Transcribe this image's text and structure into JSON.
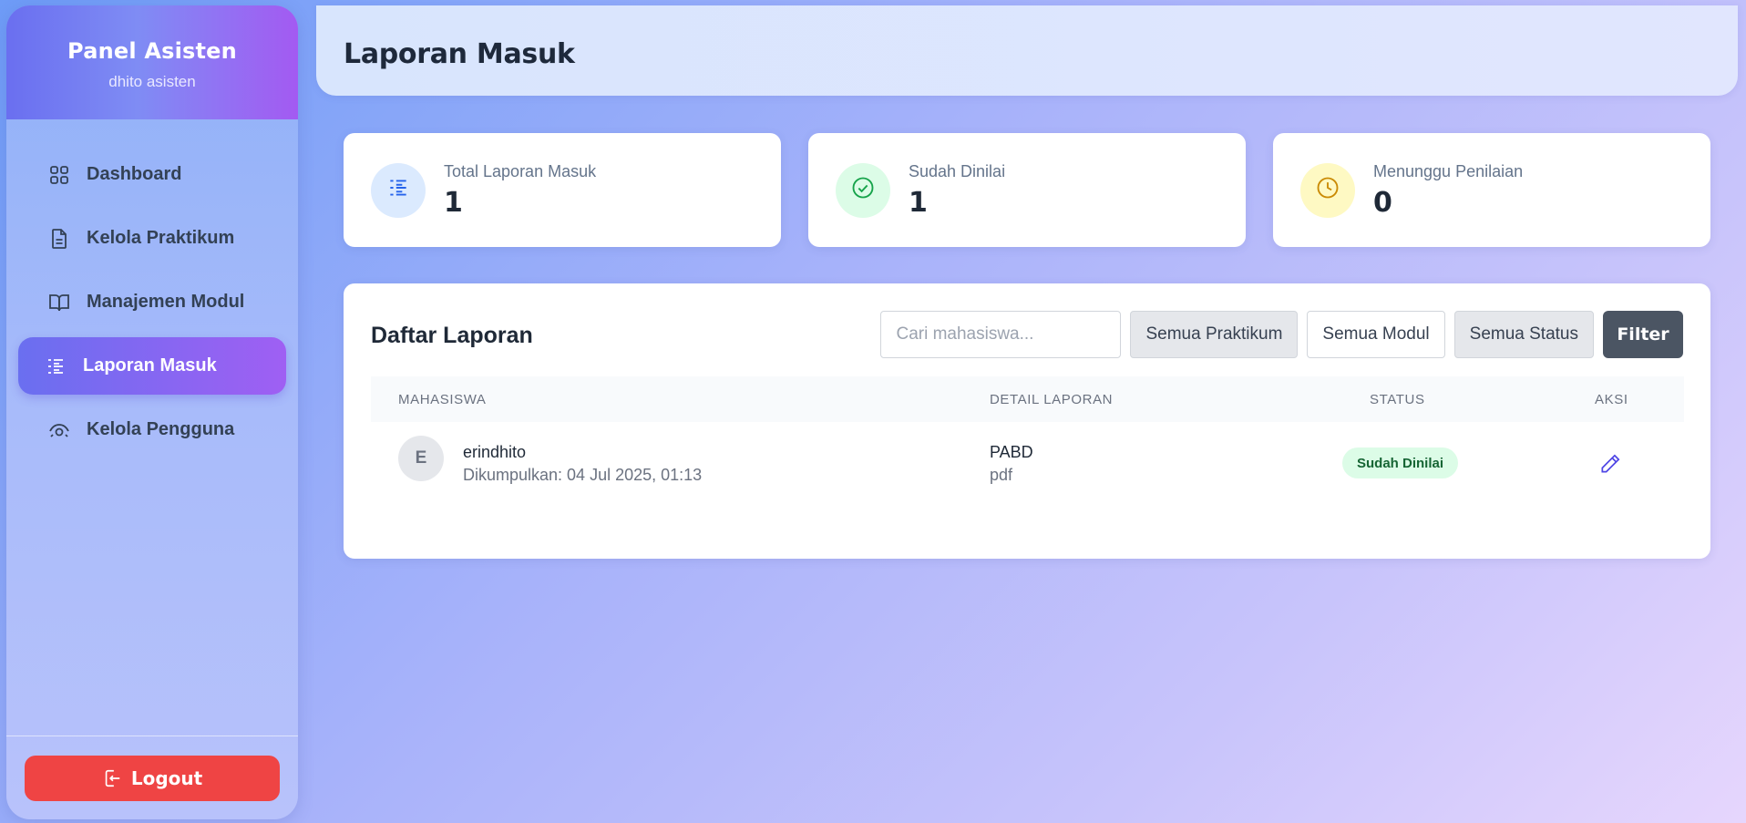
{
  "sidebar": {
    "title": "Panel Asisten",
    "subtitle": "dhito asisten",
    "items": [
      {
        "label": "Dashboard",
        "icon": "grid-icon"
      },
      {
        "label": "Kelola Praktikum",
        "icon": "document-icon"
      },
      {
        "label": "Manajemen Modul",
        "icon": "book-icon"
      },
      {
        "label": "Laporan Masuk",
        "icon": "list-icon",
        "active": true
      },
      {
        "label": "Kelola Pengguna",
        "icon": "eye-icon"
      }
    ],
    "logout_label": "Logout"
  },
  "header": {
    "title": "Laporan Masuk"
  },
  "stats": [
    {
      "label": "Total Laporan Masuk",
      "value": "1",
      "color": "#2563eb",
      "bg": "#dbeafe",
      "icon": "list-icon"
    },
    {
      "label": "Sudah Dinilai",
      "value": "1",
      "color": "#16a34a",
      "bg": "#dcfce7",
      "icon": "check-circle-icon"
    },
    {
      "label": "Menunggu Penilaian",
      "value": "0",
      "color": "#ca8a04",
      "bg": "#fef9c3",
      "icon": "clock-icon"
    }
  ],
  "reports": {
    "title": "Daftar Laporan",
    "search_placeholder": "Cari mahasiswa...",
    "filter_praktikum": "Semua Praktikum",
    "filter_modul": "Semua Modul",
    "filter_status": "Semua Status",
    "filter_button": "Filter",
    "columns": [
      "MAHASISWA",
      "DETAIL LAPORAN",
      "STATUS",
      "AKSI"
    ],
    "rows": [
      {
        "initial": "E",
        "name": "erindhito",
        "submitted": "Dikumpulkan: 04 Jul 2025, 01:13",
        "detail_title": "PABD",
        "detail_type": "pdf",
        "status": "Sudah Dinilai"
      }
    ]
  },
  "colors": {
    "accent": "#6a6ff0",
    "danger": "#ef4444",
    "success": "#16a34a"
  }
}
